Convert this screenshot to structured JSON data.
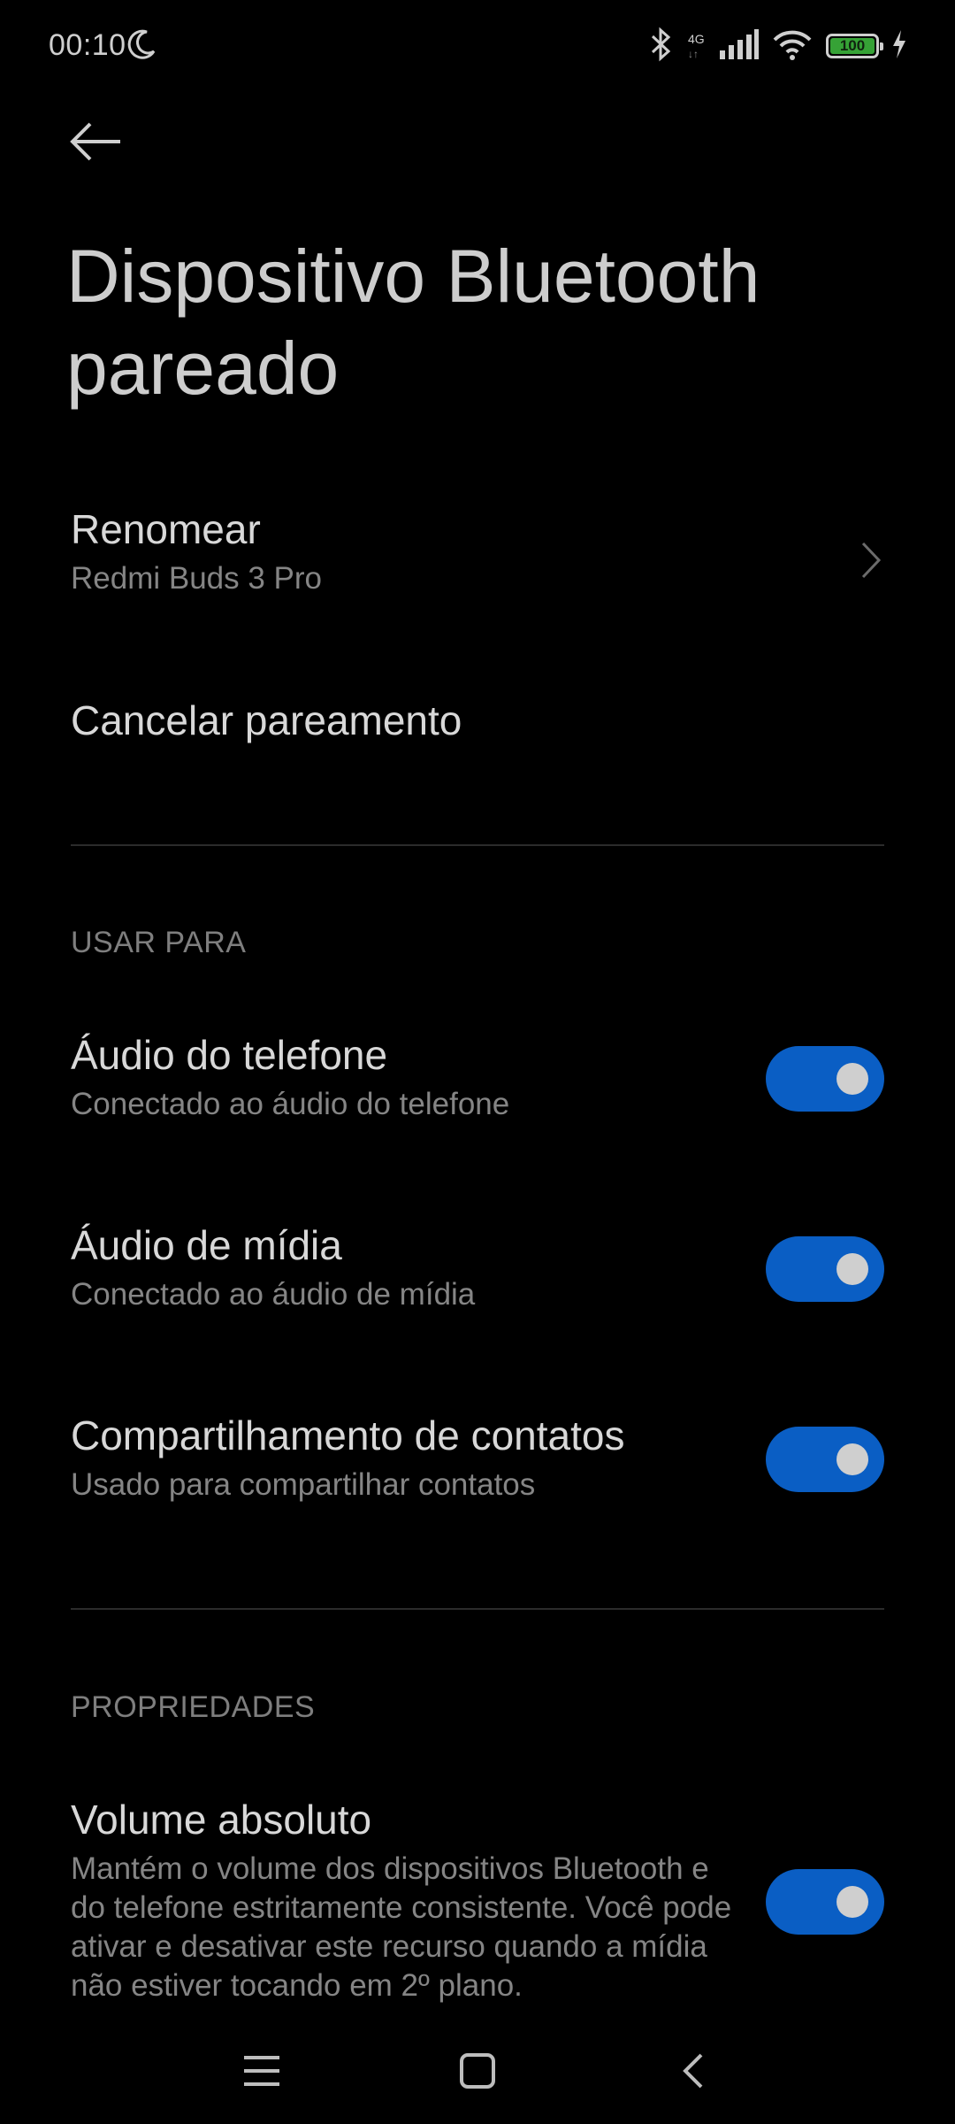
{
  "status_bar": {
    "time": "00:10",
    "network_type": "4G",
    "network_arrows": "↓↑",
    "battery_level": 100,
    "battery_text": "100",
    "icons": [
      "moon-icon",
      "bluetooth-icon",
      "signal-icon",
      "wifi-icon",
      "battery-icon",
      "charging-icon"
    ]
  },
  "header": {
    "back_icon": "arrow-left-icon",
    "title": "Dispositivo Bluetooth pareado"
  },
  "device": {
    "rename_label": "Renomear",
    "device_name": "Redmi Buds 3 Pro",
    "unpair_label": "Cancelar pareamento"
  },
  "use_for": {
    "header": "USAR PARA",
    "items": [
      {
        "title": "Áudio do telefone",
        "subtitle": "Conectado ao áudio do telefone",
        "enabled": true
      },
      {
        "title": "Áudio de mídia",
        "subtitle": "Conectado ao áudio de mídia",
        "enabled": true
      },
      {
        "title": "Compartilhamento de contatos",
        "subtitle": "Usado para compartilhar contatos",
        "enabled": true
      }
    ]
  },
  "properties": {
    "header": "PROPRIEDADES",
    "absolute_volume": {
      "title": "Volume absoluto",
      "description": "Mantém o volume dos dispositivos Bluetooth e do telefone estritamente consistente. Você pode ativar e desativar este recurso quando a mídia não estiver tocando em 2º plano.",
      "enabled": true
    }
  },
  "nav_bar": {
    "icons": [
      "menu-icon",
      "home-icon",
      "back-icon"
    ]
  },
  "colors": {
    "background": "#000000",
    "toggle_on": "#0a5ec4",
    "battery_fill": "#36a236"
  }
}
